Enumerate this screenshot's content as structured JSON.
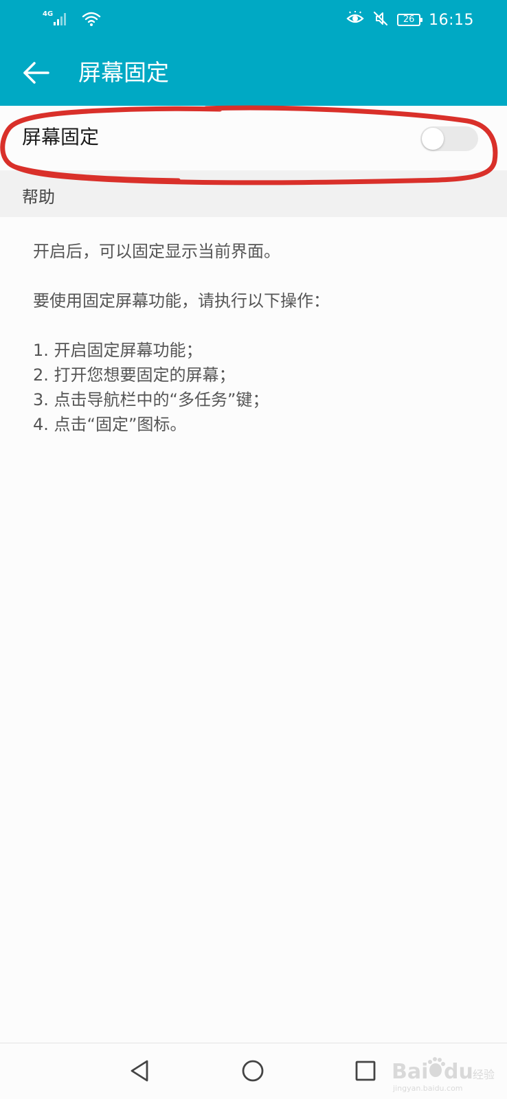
{
  "status_bar": {
    "network_type": "4G",
    "battery_level": "26",
    "time": "16:15",
    "icons": [
      "signal-icon",
      "wifi-icon",
      "eye-comfort-icon",
      "mute-icon",
      "battery-icon"
    ]
  },
  "app_bar": {
    "title": "屏幕固定",
    "back_icon": "arrow-left-icon"
  },
  "setting": {
    "label": "屏幕固定",
    "switch_on": false
  },
  "help": {
    "header": "帮助",
    "intro": "开启后，可以固定显示当前界面。",
    "instruction": "要使用固定屏幕功能，请执行以下操作：",
    "steps": [
      "1. 开启固定屏幕功能；",
      "2. 打开您想要固定的屏幕；",
      "3. 点击导航栏中的“多任务”键；",
      "4. 点击“固定”图标。"
    ]
  },
  "nav_bar": {
    "icons": [
      "nav-back-icon",
      "nav-home-icon",
      "nav-recent-icon"
    ]
  },
  "watermark": {
    "brand": "Baidu经验",
    "url": "jingyan.baidu.com"
  },
  "colors": {
    "accent": "#00a9c4",
    "annotation": "#d9302a",
    "switch_off": "#e9e9e9"
  }
}
